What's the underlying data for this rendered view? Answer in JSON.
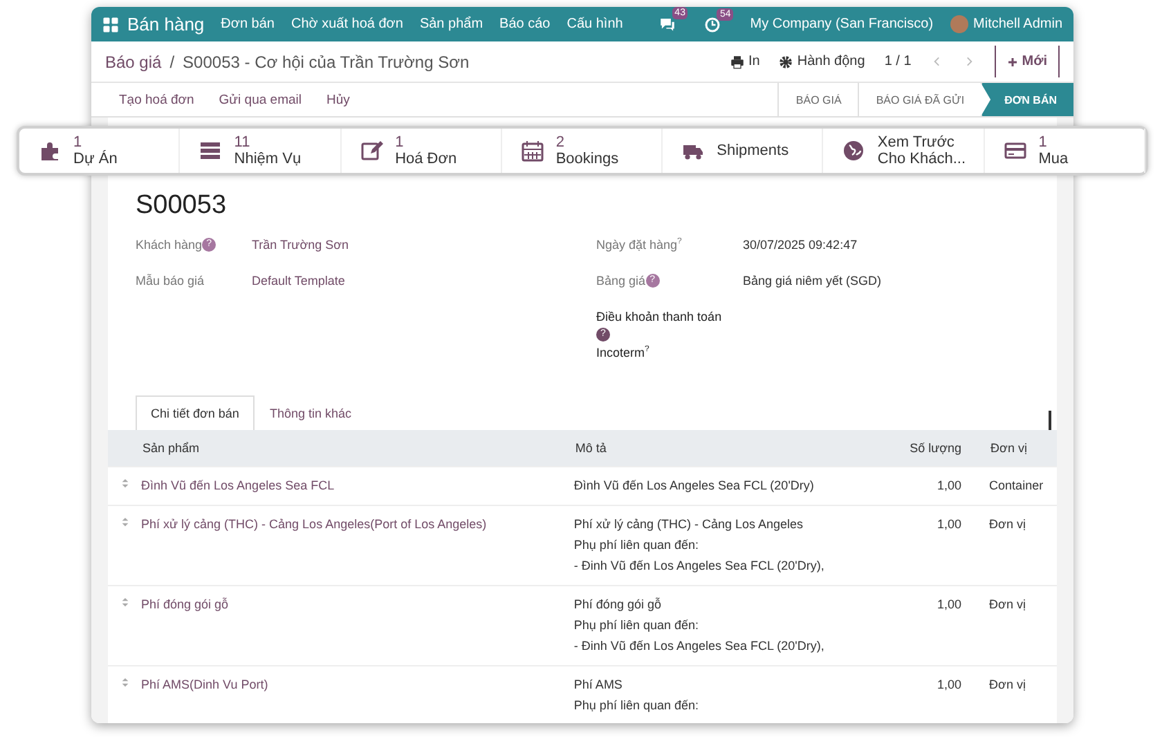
{
  "navbar": {
    "app": "Bán hàng",
    "menus": [
      "Đơn bán",
      "Chờ xuất hoá đơn",
      "Sản phẩm",
      "Báo cáo",
      "Cấu hình"
    ],
    "messages_badge": "43",
    "activities_badge": "54",
    "company": "My Company (San Francisco)",
    "user": "Mitchell Admin"
  },
  "breadcrumb": {
    "parent": "Báo giá",
    "separator": "/",
    "current": "S00053 - Cơ hội của Trần Trường Sơn"
  },
  "control_panel": {
    "print": "In",
    "action": "Hành động",
    "pager": "1 / 1",
    "new": "Mới"
  },
  "actions": [
    "Tạo hoá đơn",
    "Gửi qua email",
    "Hủy"
  ],
  "stages": [
    {
      "label": "BÁO GIÁ",
      "selected": false
    },
    {
      "label": "BÁO GIÁ ĐÃ GỬI",
      "selected": false
    },
    {
      "label": "ĐƠN BÁN",
      "selected": true
    }
  ],
  "smart_buttons": [
    {
      "kind": "puzzle",
      "count": "1",
      "label": "Dự Án"
    },
    {
      "kind": "tasks",
      "count": "11",
      "label": "Nhiệm Vụ"
    },
    {
      "kind": "invoice",
      "count": "1",
      "label": "Hoá Đơn"
    },
    {
      "kind": "calendar",
      "count": "2",
      "label": "Bookings"
    },
    {
      "kind": "truck",
      "label": "Shipments"
    },
    {
      "kind": "globe",
      "label": "Xem Trước Cho Khách..."
    },
    {
      "kind": "card",
      "count": "1",
      "label": "Mua"
    }
  ],
  "record": {
    "title": "S00053",
    "left_fields": [
      {
        "label": "Khách hàng",
        "help": {
          "kind": "circle",
          "text": "?"
        },
        "value": "Trần Trường Sơn",
        "link": true
      },
      {
        "label": "Mẫu báo giá",
        "value": "Default Template",
        "link": true
      }
    ],
    "right_fields": [
      {
        "label": "Ngày đặt hàng",
        "help": {
          "kind": "sup",
          "text": "?"
        },
        "value": "30/07/2025 09:42:47",
        "link": false
      },
      {
        "label": "Bảng giá",
        "help": {
          "kind": "circle",
          "text": "?"
        },
        "value": "Bảng giá niêm yết (SGD)",
        "link": false
      },
      {
        "label": "Điều khoản thanh toán",
        "help": {
          "kind": "block",
          "text": "?"
        },
        "strong": true
      },
      {
        "label": "Incoterm",
        "help": {
          "kind": "sup",
          "text": "?"
        },
        "strong": true
      }
    ]
  },
  "tabs": [
    {
      "label": "Chi tiết đơn bán",
      "selected": true
    },
    {
      "label": "Thông tin khác",
      "selected": false
    }
  ],
  "table": {
    "columns": [
      "Sản phẩm",
      "Mô tả",
      "Số lượng",
      "Đơn vị"
    ],
    "rows": [
      {
        "product": "Đình Vũ đến Los Angeles Sea FCL",
        "description": [
          "Đình Vũ đến Los Angeles Sea FCL (20'Dry)"
        ],
        "quantity": "1,00",
        "unit": "Container"
      },
      {
        "product": "Phí xử lý cảng (THC) - Cảng Los Angeles(Port of Los Angeles)",
        "description": [
          "Phí xử lý cảng (THC) - Cảng Los Angeles",
          "Phụ phí liên quan đến:",
          " - Đinh Vũ đến Los Angeles Sea FCL (20'Dry),"
        ],
        "quantity": "1,00",
        "unit": "Đơn vị"
      },
      {
        "product": "Phí đóng gói gỗ",
        "description": [
          "Phí đóng gói gỗ",
          "Phụ phí liên quan đến:",
          " - Đinh Vũ đến Los Angeles Sea FCL (20'Dry),"
        ],
        "quantity": "1,00",
        "unit": "Đơn vị"
      },
      {
        "product": "Phí AMS(Dinh Vu Port)",
        "description": [
          "Phí AMS",
          "Phụ phí liên quan đến:"
        ],
        "quantity": "1,00",
        "unit": "Đơn vị"
      }
    ]
  }
}
